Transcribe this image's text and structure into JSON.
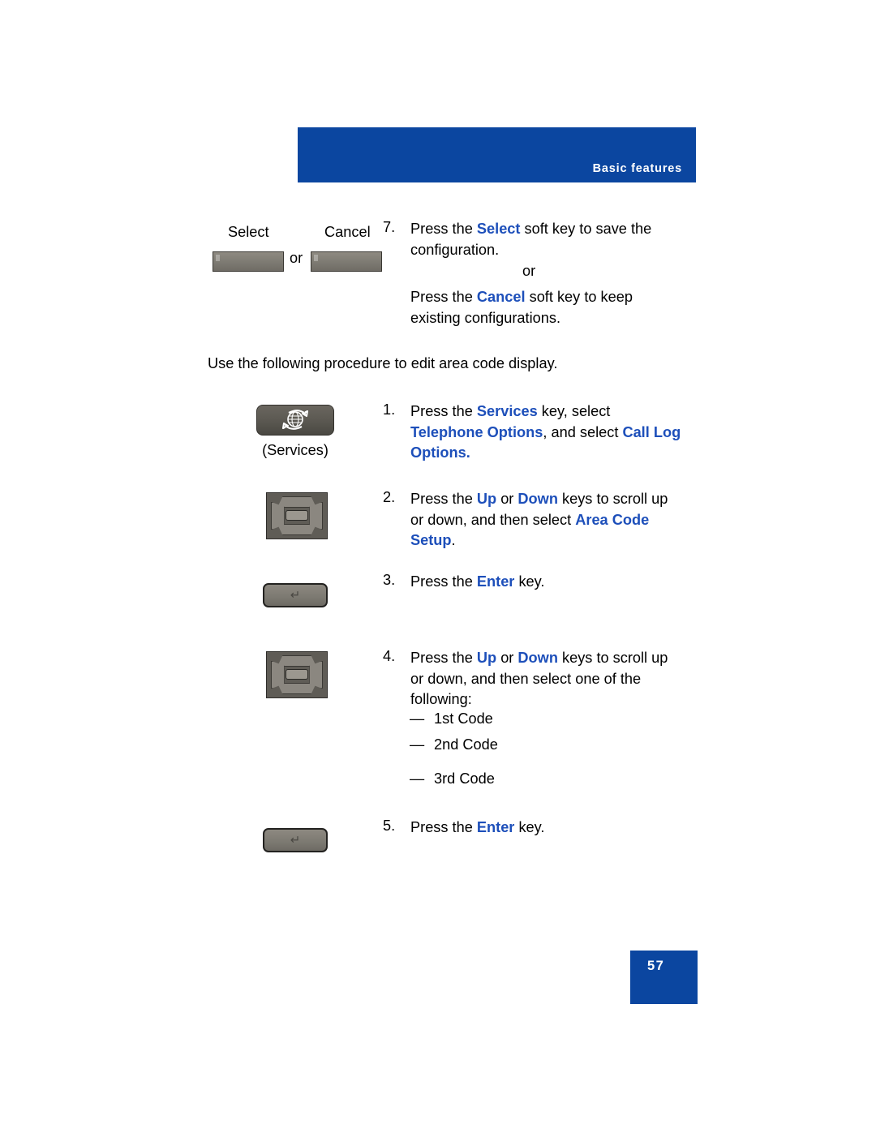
{
  "header": {
    "title": "Basic features",
    "banner_color": "#0b46a0"
  },
  "accent_color": "#1d4fba",
  "step7": {
    "number": "7.",
    "softkey_labels": {
      "select": "Select",
      "cancel": "Cancel"
    },
    "or_between_keys": "or",
    "line1_prefix": "Press the ",
    "line1_keyword": "Select",
    "line1_suffix": " soft key to save the configuration.",
    "or_center": "or",
    "line2_prefix": "Press the ",
    "line2_keyword": "Cancel",
    "line2_suffix": " soft key to keep existing configurations."
  },
  "intro_paragraph": "Use the following procedure to edit area code display.",
  "keys": {
    "services_caption": "(Services)",
    "services_icon": "globe-arrows-icon",
    "navigation_icon": "navigation-rocker-icon",
    "enter_icon": "enter-return-icon"
  },
  "steps": [
    {
      "number": "1.",
      "prefix": "Press the ",
      "keyword1": "Services",
      "mid1": " key, select ",
      "keyword2": "Telephone Options",
      "mid2": ", and select ",
      "keyword3": "Call Log Options",
      "suffix": "."
    },
    {
      "number": "2.",
      "prefix": "Press the ",
      "keyword1": "Up",
      "mid1": " or ",
      "keyword2": "Down",
      "mid2": " keys to scroll up or down, and then select ",
      "keyword3": "Area Code Setup",
      "suffix": "."
    },
    {
      "number": "3.",
      "prefix": "Press the ",
      "keyword1": "Enter",
      "suffix": " key."
    },
    {
      "number": "4.",
      "prefix": "Press the ",
      "keyword1": "Up",
      "mid1": " or ",
      "keyword2": "Down",
      "mid2": " keys to scroll up or down, and then select one of the following:"
    },
    {
      "number": "5.",
      "prefix": "Press the ",
      "keyword1": "Enter",
      "suffix": " key."
    }
  ],
  "code_options": [
    {
      "dash": "—",
      "label": "1st Code"
    },
    {
      "dash": "—",
      "label": "2nd Code"
    },
    {
      "dash": "—",
      "label": "3rd Code"
    }
  ],
  "footer": {
    "page_number": "57"
  }
}
